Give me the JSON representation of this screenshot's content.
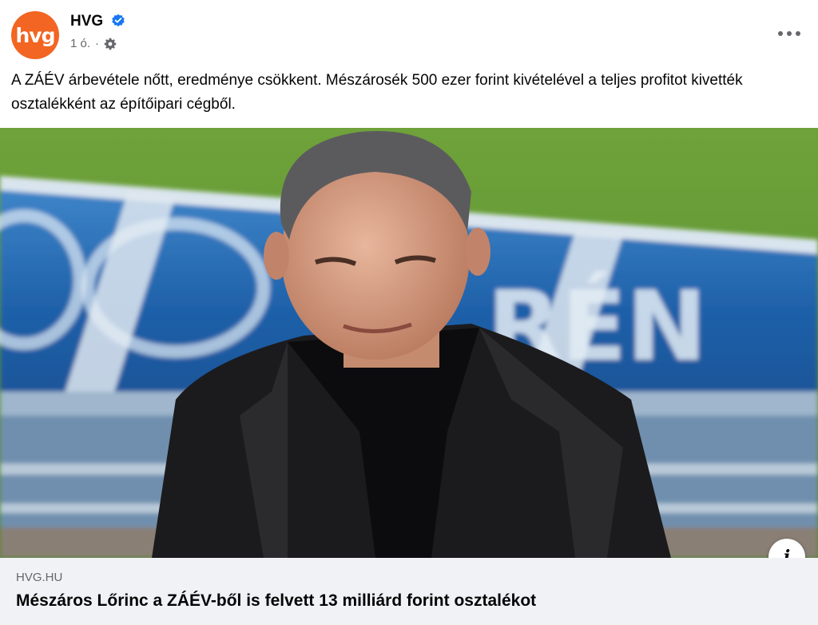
{
  "header": {
    "avatar_text": "hvg",
    "page_name": "HVG",
    "timestamp": "1 ó.",
    "separator": "·",
    "verified_icon": "verified-badge-icon",
    "privacy_icon": "gear-icon",
    "more_icon": "more-options-icon"
  },
  "post": {
    "text": "A ZÁÉV árbevétele nőtt, eredménye csökkent. Mészárosék 500 ezer forint kivételével a teljes profitot kivették osztalékként az építőipari cégből."
  },
  "image": {
    "banner_text": "RÉN",
    "info_label": "i"
  },
  "link": {
    "domain": "HVG.HU",
    "title": "Mészáros Lőrinc a ZÁÉV-ből is felvett 13 milliárd forint osztalékot"
  },
  "colors": {
    "brand": "#f26522",
    "verified": "#1877f2",
    "secondary_text": "#65676b",
    "link_bg": "#f0f2f5"
  }
}
